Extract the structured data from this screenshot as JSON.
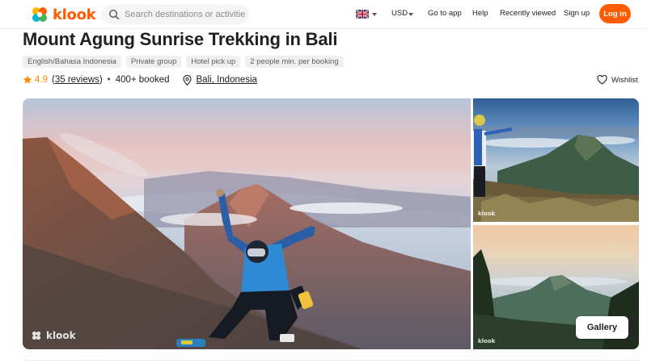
{
  "brand": {
    "name": "klook",
    "color": "#ff5b00"
  },
  "header": {
    "search_placeholder": "Search destinations or activities",
    "language_flag": "uk-flag-icon",
    "currency": "USD",
    "nav": {
      "go_to_app": "Go to app",
      "help": "Help",
      "recently_viewed": "Recently viewed",
      "sign_up": "Sign up",
      "log_in": "Log in"
    }
  },
  "activity": {
    "title": "Mount Agung Sunrise Trekking in Bali",
    "tags": [
      "English/Bahasa Indonesia",
      "Private group",
      "Hotel pick up",
      "2 people min. per booking"
    ],
    "rating": "4.9",
    "reviews": "35 reviews",
    "booked": "400+ booked",
    "location": "Bali, Indonesia",
    "wishlist_label": "Wishlist"
  },
  "gallery": {
    "button_label": "Gallery",
    "watermark": "klook"
  },
  "colors": {
    "rating_star": "#ff8f00",
    "tag_bg": "#f0f0f0"
  }
}
